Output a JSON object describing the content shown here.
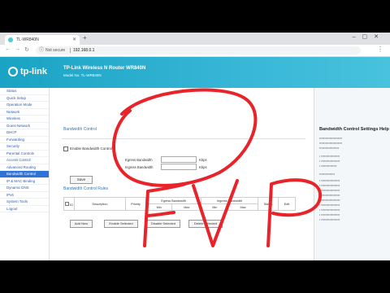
{
  "browser": {
    "tab_title": "TL-WR840N",
    "url_security": "Not secure",
    "url": "192.168.0.1"
  },
  "header": {
    "logo_text": "tp-link",
    "product_title": "TP-Link Wireless N Router WR840N",
    "model_no": "Model No. TL-WR840N"
  },
  "sidebar": {
    "items": [
      {
        "label": "Status",
        "active": false
      },
      {
        "label": "Quick Setup",
        "active": false
      },
      {
        "label": "Operation Mode",
        "active": false
      },
      {
        "label": "Network",
        "active": false
      },
      {
        "label": "Wireless",
        "active": false
      },
      {
        "label": "Guest Network",
        "active": false
      },
      {
        "label": "DHCP",
        "active": false
      },
      {
        "label": "Forwarding",
        "active": false
      },
      {
        "label": "Security",
        "active": false
      },
      {
        "label": "Parental Controls",
        "active": false
      },
      {
        "label": "Access Control",
        "active": false
      },
      {
        "label": "Advanced Routing",
        "active": false
      },
      {
        "label": "Bandwidth Control",
        "active": true
      },
      {
        "label": "IP & MAC Binding",
        "active": false
      },
      {
        "label": "Dynamic DNS",
        "active": false
      },
      {
        "label": "IPv6",
        "active": false
      },
      {
        "label": "System Tools",
        "active": false
      },
      {
        "label": "Logout",
        "active": false
      }
    ]
  },
  "main": {
    "section_title": "Bandwidth Control",
    "enable_label": "Enable Bandwidth Control",
    "egress_label": "Egress Bandwidth",
    "ingress_label": "Ingress Bandwidth",
    "unit": "Kbps",
    "save_label": "Save",
    "rules_title": "Bandwidth Control Rules",
    "table_headers": [
      "ID",
      "Description",
      "Priority",
      "Egress Bandwidth",
      "Ingress Bandwidth",
      "Status",
      "Edit"
    ],
    "table_subheaders": [
      "Min",
      "Max",
      "Min",
      "Max"
    ],
    "buttons": {
      "add_new": "Add New",
      "enable_selected": "Enable Selected",
      "disable_selected": "Disable Selected",
      "delete_selected": "Delete Selected"
    }
  },
  "help": {
    "title": "Bandwidth Control Settings Help"
  },
  "overlay": {
    "scribble_text": "FVP",
    "scribble_color": "#e8232a"
  }
}
